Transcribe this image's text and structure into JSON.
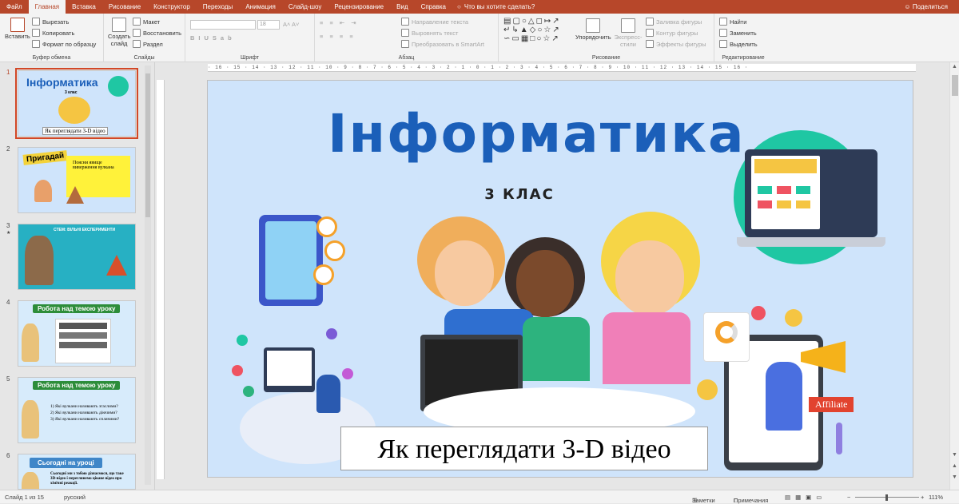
{
  "tabs": [
    "Файл",
    "Главная",
    "Вставка",
    "Рисование",
    "Конструктор",
    "Переходы",
    "Анимация",
    "Слайд-шоу",
    "Рецензирование",
    "Вид",
    "Справка"
  ],
  "active_tab": "Главная",
  "tell_me": "Что вы хотите сделать?",
  "share": "Поделиться",
  "ribbon": {
    "clipboard": {
      "paste": "Вставить",
      "cut": "Вырезать",
      "copy": "Копировать",
      "format_painter": "Формат по образцу",
      "label": "Буфер обмена"
    },
    "slides": {
      "new_slide": "Создать слайд",
      "layout": "Макет",
      "reset": "Восстановить",
      "section": "Раздел",
      "label": "Слайды"
    },
    "font": {
      "label": "Шрифт",
      "size": "18"
    },
    "paragraph": {
      "text_direction": "Направление текста",
      "align_text": "Выровнять текст",
      "smartart": "Преобразовать в SmartArt",
      "label": "Абзац"
    },
    "drawing": {
      "arrange": "Упорядочить",
      "quick_styles": "Экспресс-стили",
      "fill": "Заливка фигуры",
      "outline": "Контур фигуры",
      "effects": "Эффекты фигуры",
      "label": "Рисование"
    },
    "editing": {
      "find": "Найти",
      "replace": "Заменить",
      "select": "Выделить",
      "label": "Редактирование"
    }
  },
  "thumbnails": [
    {
      "num": "1",
      "title": "Інформатика",
      "sub": "3 клас",
      "caption": "Як переглядати 3-D відео"
    },
    {
      "num": "2",
      "title": "Пригадай",
      "text": "Поясни явище виверження вулкана"
    },
    {
      "num": "3",
      "title": "СТЕМ: ВІЛЬНІ ЕКСПЕРИМЕНТИ"
    },
    {
      "num": "4",
      "title": "Робота над темою уроку"
    },
    {
      "num": "5",
      "title": "Робота над темою уроку",
      "lines": [
        "1) Які вулкани називають згаслими?",
        "2) Які вулкани називають діючими?",
        "3) Які вулкани називають сплячими?"
      ]
    },
    {
      "num": "6",
      "title": "Сьогодні на уроці",
      "text": "Сьогодні ми з тобою дізнаємося, що таке 3D-відео і переглянемо цікаве відео про хімічні реакції."
    }
  ],
  "slide": {
    "title": "Інформатика",
    "subtitle": "3 КЛАС",
    "caption": "Як переглядати 3-D відео",
    "affiliate": "Affiliate"
  },
  "ruler": "· 16 · 15 · 14 · 13 · 12 · 11 · 10 · 9 · 8 · 7 · 6 · 5 · 4 · 3 · 2 · 1 · 0 · 1 · 2 · 3 · 4 · 5 · 6 · 7 · 8 · 9 · 10 · 11 · 12 · 13 · 14 · 15 · 16 ·",
  "status": {
    "slide": "Слайд 1 из 15",
    "lang": "русский",
    "notes": "Заметки",
    "comments": "Примечания",
    "zoom": "111%"
  },
  "colors": {
    "accent": "#b7472a",
    "title": "#1b5fb9",
    "slide_bg": "#cfe4fb"
  }
}
